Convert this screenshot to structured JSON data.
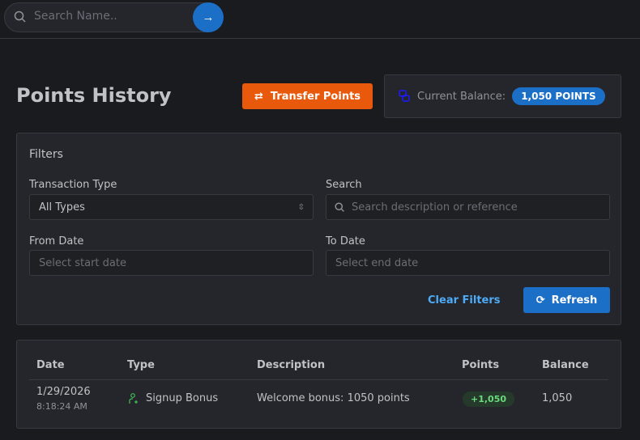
{
  "search": {
    "placeholder": "Search Name.."
  },
  "page": {
    "title": "Points History",
    "transfer_label": "Transfer Points",
    "balance_label": "Current Balance:",
    "balance_value": "1,050 POINTS"
  },
  "filters": {
    "title": "Filters",
    "type_label": "Transaction Type",
    "type_value": "All Types",
    "search_label": "Search",
    "search_placeholder": "Search description or reference",
    "from_label": "From Date",
    "from_placeholder": "Select start date",
    "to_label": "To Date",
    "to_placeholder": "Select end date",
    "clear_label": "Clear Filters",
    "refresh_label": "Refresh"
  },
  "table": {
    "headers": [
      "Date",
      "Type",
      "Description",
      "Points",
      "Balance"
    ],
    "rows": [
      {
        "date": "1/29/2026",
        "time": "8:18:24 AM",
        "type": "Signup Bonus",
        "description": "Welcome bonus: 1050 points",
        "points": "+1,050",
        "balance": "1,050"
      }
    ]
  }
}
